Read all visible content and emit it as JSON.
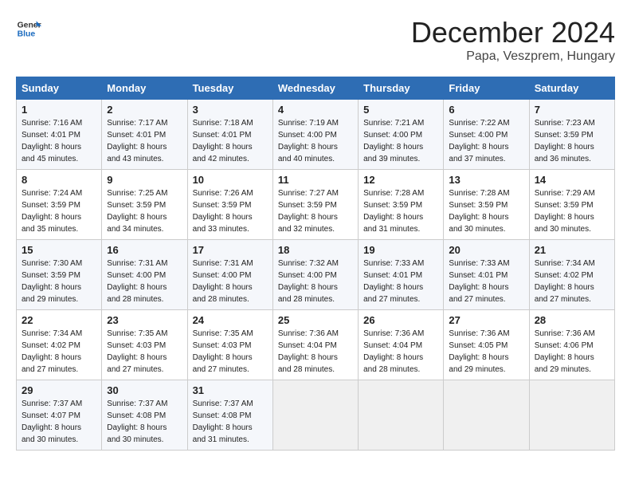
{
  "header": {
    "logo_line1": "General",
    "logo_line2": "Blue",
    "month": "December 2024",
    "location": "Papa, Veszprem, Hungary"
  },
  "weekdays": [
    "Sunday",
    "Monday",
    "Tuesday",
    "Wednesday",
    "Thursday",
    "Friday",
    "Saturday"
  ],
  "weeks": [
    [
      {
        "day": "1",
        "rise": "7:16 AM",
        "set": "4:01 PM",
        "daylight": "8 hours and 45 minutes."
      },
      {
        "day": "2",
        "rise": "7:17 AM",
        "set": "4:01 PM",
        "daylight": "8 hours and 43 minutes."
      },
      {
        "day": "3",
        "rise": "7:18 AM",
        "set": "4:01 PM",
        "daylight": "8 hours and 42 minutes."
      },
      {
        "day": "4",
        "rise": "7:19 AM",
        "set": "4:00 PM",
        "daylight": "8 hours and 40 minutes."
      },
      {
        "day": "5",
        "rise": "7:21 AM",
        "set": "4:00 PM",
        "daylight": "8 hours and 39 minutes."
      },
      {
        "day": "6",
        "rise": "7:22 AM",
        "set": "4:00 PM",
        "daylight": "8 hours and 37 minutes."
      },
      {
        "day": "7",
        "rise": "7:23 AM",
        "set": "3:59 PM",
        "daylight": "8 hours and 36 minutes."
      }
    ],
    [
      {
        "day": "8",
        "rise": "7:24 AM",
        "set": "3:59 PM",
        "daylight": "8 hours and 35 minutes."
      },
      {
        "day": "9",
        "rise": "7:25 AM",
        "set": "3:59 PM",
        "daylight": "8 hours and 34 minutes."
      },
      {
        "day": "10",
        "rise": "7:26 AM",
        "set": "3:59 PM",
        "daylight": "8 hours and 33 minutes."
      },
      {
        "day": "11",
        "rise": "7:27 AM",
        "set": "3:59 PM",
        "daylight": "8 hours and 32 minutes."
      },
      {
        "day": "12",
        "rise": "7:28 AM",
        "set": "3:59 PM",
        "daylight": "8 hours and 31 minutes."
      },
      {
        "day": "13",
        "rise": "7:28 AM",
        "set": "3:59 PM",
        "daylight": "8 hours and 30 minutes."
      },
      {
        "day": "14",
        "rise": "7:29 AM",
        "set": "3:59 PM",
        "daylight": "8 hours and 30 minutes."
      }
    ],
    [
      {
        "day": "15",
        "rise": "7:30 AM",
        "set": "3:59 PM",
        "daylight": "8 hours and 29 minutes."
      },
      {
        "day": "16",
        "rise": "7:31 AM",
        "set": "4:00 PM",
        "daylight": "8 hours and 28 minutes."
      },
      {
        "day": "17",
        "rise": "7:31 AM",
        "set": "4:00 PM",
        "daylight": "8 hours and 28 minutes."
      },
      {
        "day": "18",
        "rise": "7:32 AM",
        "set": "4:00 PM",
        "daylight": "8 hours and 28 minutes."
      },
      {
        "day": "19",
        "rise": "7:33 AM",
        "set": "4:01 PM",
        "daylight": "8 hours and 27 minutes."
      },
      {
        "day": "20",
        "rise": "7:33 AM",
        "set": "4:01 PM",
        "daylight": "8 hours and 27 minutes."
      },
      {
        "day": "21",
        "rise": "7:34 AM",
        "set": "4:02 PM",
        "daylight": "8 hours and 27 minutes."
      }
    ],
    [
      {
        "day": "22",
        "rise": "7:34 AM",
        "set": "4:02 PM",
        "daylight": "8 hours and 27 minutes."
      },
      {
        "day": "23",
        "rise": "7:35 AM",
        "set": "4:03 PM",
        "daylight": "8 hours and 27 minutes."
      },
      {
        "day": "24",
        "rise": "7:35 AM",
        "set": "4:03 PM",
        "daylight": "8 hours and 27 minutes."
      },
      {
        "day": "25",
        "rise": "7:36 AM",
        "set": "4:04 PM",
        "daylight": "8 hours and 28 minutes."
      },
      {
        "day": "26",
        "rise": "7:36 AM",
        "set": "4:04 PM",
        "daylight": "8 hours and 28 minutes."
      },
      {
        "day": "27",
        "rise": "7:36 AM",
        "set": "4:05 PM",
        "daylight": "8 hours and 29 minutes."
      },
      {
        "day": "28",
        "rise": "7:36 AM",
        "set": "4:06 PM",
        "daylight": "8 hours and 29 minutes."
      }
    ],
    [
      {
        "day": "29",
        "rise": "7:37 AM",
        "set": "4:07 PM",
        "daylight": "8 hours and 30 minutes."
      },
      {
        "day": "30",
        "rise": "7:37 AM",
        "set": "4:08 PM",
        "daylight": "8 hours and 30 minutes."
      },
      {
        "day": "31",
        "rise": "7:37 AM",
        "set": "4:08 PM",
        "daylight": "8 hours and 31 minutes."
      },
      null,
      null,
      null,
      null
    ]
  ]
}
